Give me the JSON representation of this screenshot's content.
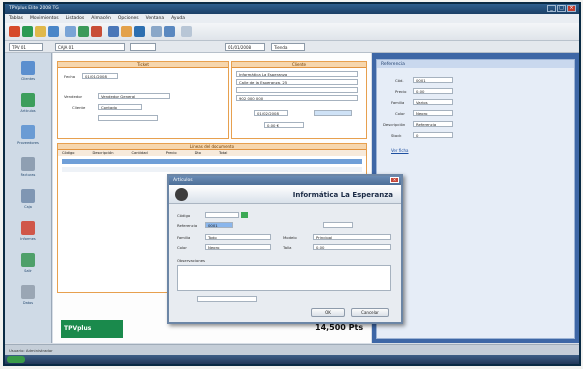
{
  "window": {
    "title": "TPVplus Elite 2008 TG"
  },
  "menu": [
    "Tablas",
    "Movimientos",
    "Listados",
    "Almacén",
    "Opciones",
    "Ventana",
    "Ayuda"
  ],
  "toolbar2": {
    "combo1": "TPV 01",
    "combo2": "CAJA 01",
    "combo3": "01/01/2008",
    "combo4": "Tienda"
  },
  "sidebar": [
    {
      "label": "Clientes"
    },
    {
      "label": "Artículos"
    },
    {
      "label": "Proveedores"
    },
    {
      "label": "Facturas"
    },
    {
      "label": "Caja"
    },
    {
      "label": "Informes"
    },
    {
      "label": "Salir"
    },
    {
      "label": "Datos"
    }
  ],
  "ticket_panel": {
    "header": "Ticket",
    "fecha_label": "Fecha",
    "fecha_value": "01/01/2008",
    "vendedor_label": "Vendedor",
    "vendedor_value": "Vendedor General",
    "cliente_label": "Cliente",
    "cliente_value": "Contado"
  },
  "client_panel": {
    "header": "Cliente",
    "name": "Informática La Esperanza",
    "street": "Calle de la Esperanza, 25",
    "phone": "902 000 000",
    "field1": "01/02/2008",
    "field2": "0,00 €"
  },
  "lines_panel": {
    "header": "Líneas del documento",
    "cols": [
      "Código",
      "Descripción",
      "Cantidad",
      "Precio",
      "Dto",
      "Total"
    ]
  },
  "status": {
    "text": "Usuario: Administrador"
  },
  "brand": {
    "logo": "TPVplus",
    "total": "14,500 Pts"
  },
  "right_panel": {
    "header": "Referencia",
    "rows": [
      {
        "label": "Cód.",
        "value": "0001"
      },
      {
        "label": "Precio",
        "value": "0,00"
      },
      {
        "label": "Familia",
        "value": "Varios"
      },
      {
        "label": "Color",
        "value": "Negro"
      },
      {
        "label": "Descripción",
        "value": "Referencia"
      },
      {
        "label": "Stock",
        "value": "0"
      }
    ],
    "link": "Ver ficha"
  },
  "dialog": {
    "title": "Artículos",
    "heading": "Informática La Esperanza",
    "fields": [
      {
        "label": "Código",
        "value": ""
      },
      {
        "label": "Referencia",
        "value": "0001"
      },
      {
        "label": "Familia",
        "value": "Todo"
      },
      {
        "label": "Color",
        "value": "Negro"
      },
      {
        "label": "Modelo",
        "value": "Principal"
      },
      {
        "label": "Talla",
        "value": "0,00"
      }
    ],
    "observaciones_label": "Observaciones",
    "ok_label": "OK",
    "cancel_label": "Cancelar"
  },
  "colors": {
    "accent": "#e7a04f",
    "brand_green": "#1a8a4c",
    "right_blue": "#3e67a6"
  }
}
